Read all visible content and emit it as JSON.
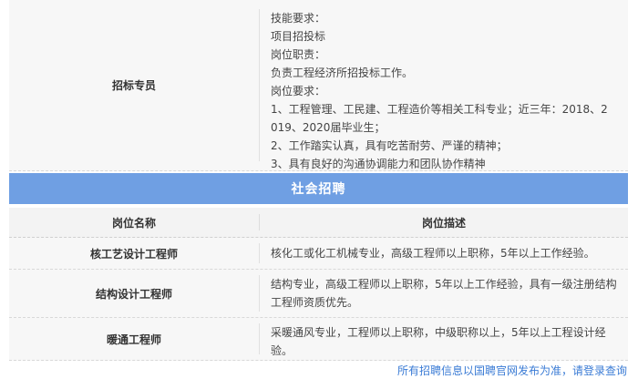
{
  "bidding": {
    "title": "招标专员",
    "lines": [
      "技能要求：",
      "项目招投标",
      "岗位职责：",
      "负责工程经济所招投标工作。",
      "岗位要求：",
      "1、工程管理、工民建、工程造价等相关工科专业；近三年：2018、2",
      "019、2020届毕业生；",
      "2、工作踏实认真，具有吃苦耐劳、严谨的精神；",
      "3、具有良好的沟通协调能力和团队协作精神"
    ]
  },
  "section": {
    "title": "社会招聘"
  },
  "table_head": {
    "name": "岗位名称",
    "desc": "岗位描述"
  },
  "jobs": [
    {
      "name": "核工艺设计工程师",
      "desc": "核化工或化工机械专业，高级工程师以上职称，5年以上工作经验。"
    },
    {
      "name": "结构设计工程师",
      "desc": "结构专业，高级工程师以上职称，5年以上工作经验，具有一级注册结构工程师资质优先。"
    },
    {
      "name": "暖通工程师",
      "desc": "采暖通风专业，工程师以上职称，中级职称以上，5年以上工程设计经验。"
    }
  ],
  "footer": {
    "note": "所有招聘信息以国聘官网发布为准，请登录查询"
  }
}
